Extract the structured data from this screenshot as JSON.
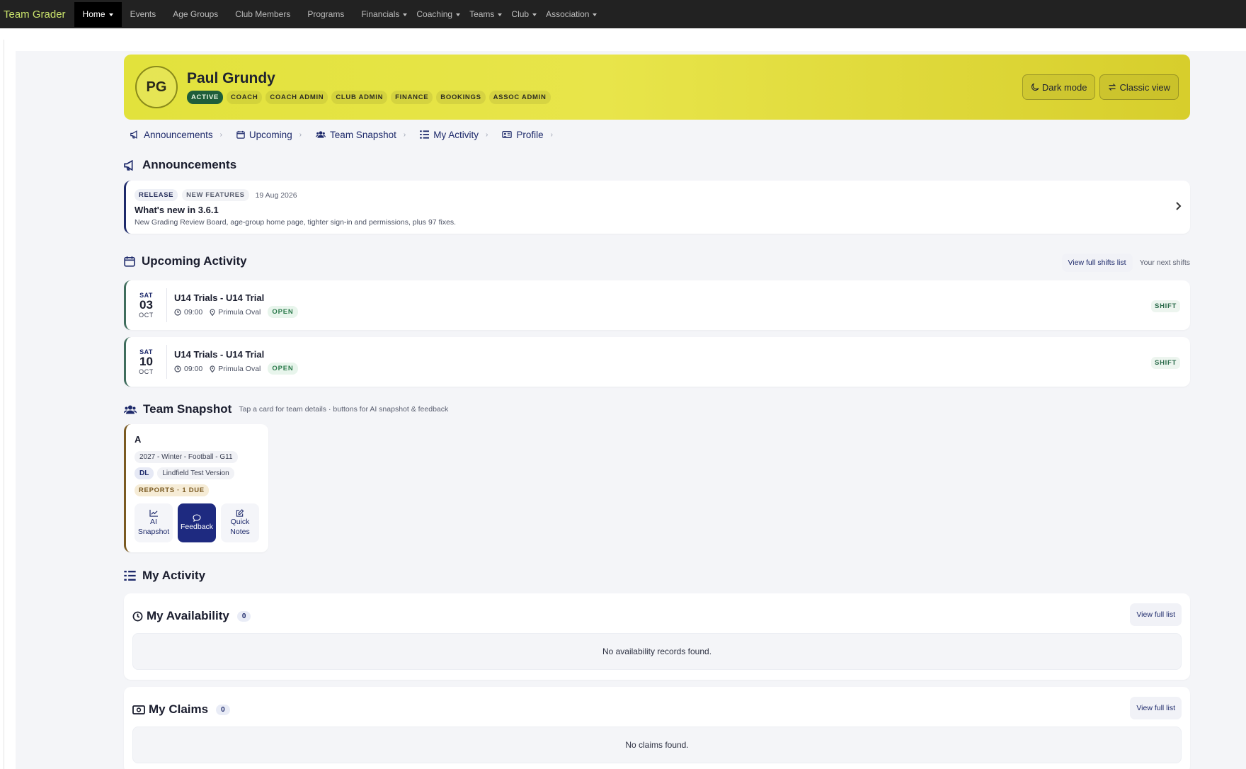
{
  "topnav": {
    "brand": "Team Grader",
    "items": [
      {
        "label": "Home",
        "dropdown": true,
        "active": true
      },
      {
        "label": "Events",
        "dropdown": false
      },
      {
        "label": "Age Groups",
        "dropdown": false
      },
      {
        "label": "Club Members",
        "dropdown": false
      },
      {
        "label": "Programs",
        "dropdown": false
      },
      {
        "label": "Financials",
        "dropdown": true
      },
      {
        "label": "Coaching",
        "dropdown": true
      },
      {
        "label": "Teams",
        "dropdown": true
      },
      {
        "label": "Club",
        "dropdown": true
      },
      {
        "label": "Association",
        "dropdown": true
      }
    ]
  },
  "hero": {
    "initials": "PG",
    "name": "Paul Grundy",
    "badges": [
      "ACTIVE",
      "COACH",
      "COACH ADMIN",
      "CLUB ADMIN",
      "FINANCE",
      "BOOKINGS",
      "ASSOC ADMIN"
    ],
    "dark_mode_label": "Dark mode",
    "classic_view_label": "Classic view"
  },
  "subnav": [
    {
      "label": "Announcements",
      "icon": "megaphone-icon"
    },
    {
      "label": "Upcoming",
      "icon": "calendar-icon"
    },
    {
      "label": "Team Snapshot",
      "icon": "users-icon"
    },
    {
      "label": "My Activity",
      "icon": "list-icon"
    },
    {
      "label": "Profile",
      "icon": "id-card-icon"
    }
  ],
  "announcements": {
    "title": "Announcements",
    "items": [
      {
        "tags": [
          "RELEASE",
          "NEW FEATURES"
        ],
        "date": "19 Aug 2026",
        "title": "What's new in 3.6.1",
        "body": "New Grading Review Board, age-group home page, tighter sign-in and permissions, plus 97 fixes."
      }
    ]
  },
  "upcoming": {
    "title": "Upcoming Activity",
    "view_full_label": "View full shifts list",
    "next_shifts_label": "Your next shifts",
    "shifts": [
      {
        "dow": "SAT",
        "day": "03",
        "month": "OCT",
        "title": "U14 Trials - U14 Trial",
        "time": "09:00",
        "location": "Primula Oval",
        "status": "OPEN",
        "type": "SHIFT"
      },
      {
        "dow": "SAT",
        "day": "10",
        "month": "OCT",
        "title": "U14 Trials - U14 Trial",
        "time": "09:00",
        "location": "Primula Oval",
        "status": "OPEN",
        "type": "SHIFT"
      }
    ]
  },
  "team_snapshot": {
    "title": "Team Snapshot",
    "subtitle": "Tap a card for team details · buttons for AI snapshot & feedback",
    "teams": [
      {
        "name": "A",
        "season": "2027 - Winter - Football - G11",
        "initials": "DL",
        "club": "Lindfield Test Version",
        "reports": "REPORTS · 1 DUE",
        "actions": {
          "ai_snapshot": "AI Snapshot",
          "feedback": "Feedback",
          "quick_notes": "Quick Notes"
        }
      }
    ]
  },
  "my_activity": {
    "title": "My Activity",
    "sections": [
      {
        "title": "My Availability",
        "count": "0",
        "button": "View full list",
        "empty": "No availability records found."
      },
      {
        "title": "My Claims",
        "count": "0",
        "button": "View full list",
        "empty": "No claims found."
      }
    ]
  }
}
